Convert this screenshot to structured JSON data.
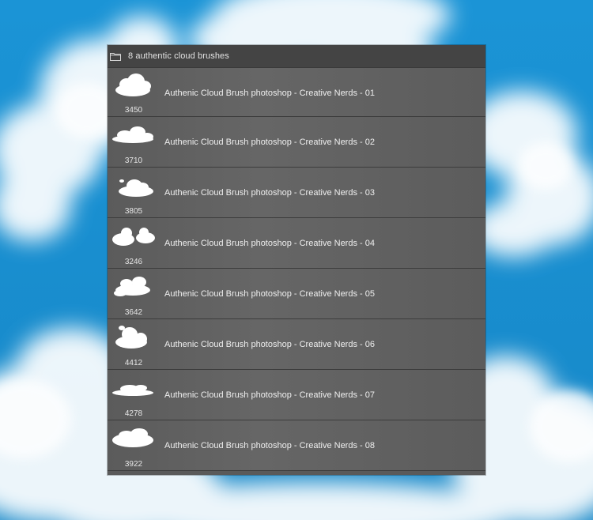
{
  "panel": {
    "title": "8 authentic cloud brushes",
    "folder_icon": "folder-icon"
  },
  "brushes": [
    {
      "name": "Authenic Cloud Brush photoshop - Creative Nerds - 01",
      "size": "3450",
      "icon": "cloud-brush-thumbnail"
    },
    {
      "name": "Authenic Cloud Brush photoshop - Creative Nerds - 02",
      "size": "3710",
      "icon": "cloud-brush-thumbnail"
    },
    {
      "name": "Authenic Cloud Brush photoshop - Creative Nerds - 03",
      "size": "3805",
      "icon": "cloud-brush-thumbnail"
    },
    {
      "name": "Authenic Cloud Brush photoshop - Creative Nerds - 04",
      "size": "3246",
      "icon": "cloud-brush-thumbnail"
    },
    {
      "name": "Authenic Cloud Brush photoshop - Creative Nerds - 05",
      "size": "3642",
      "icon": "cloud-brush-thumbnail"
    },
    {
      "name": "Authenic Cloud Brush photoshop - Creative Nerds - 06",
      "size": "4412",
      "icon": "cloud-brush-thumbnail"
    },
    {
      "name": "Authenic Cloud Brush photoshop - Creative Nerds - 07",
      "size": "4278",
      "icon": "cloud-brush-thumbnail"
    },
    {
      "name": "Authenic Cloud Brush photoshop - Creative Nerds - 08",
      "size": "3922",
      "icon": "cloud-brush-thumbnail"
    }
  ],
  "colors": {
    "sky": "#1a8fd0",
    "panel_bg": "#5a5a5a",
    "panel_header": "#444444",
    "text": "#efefef"
  }
}
